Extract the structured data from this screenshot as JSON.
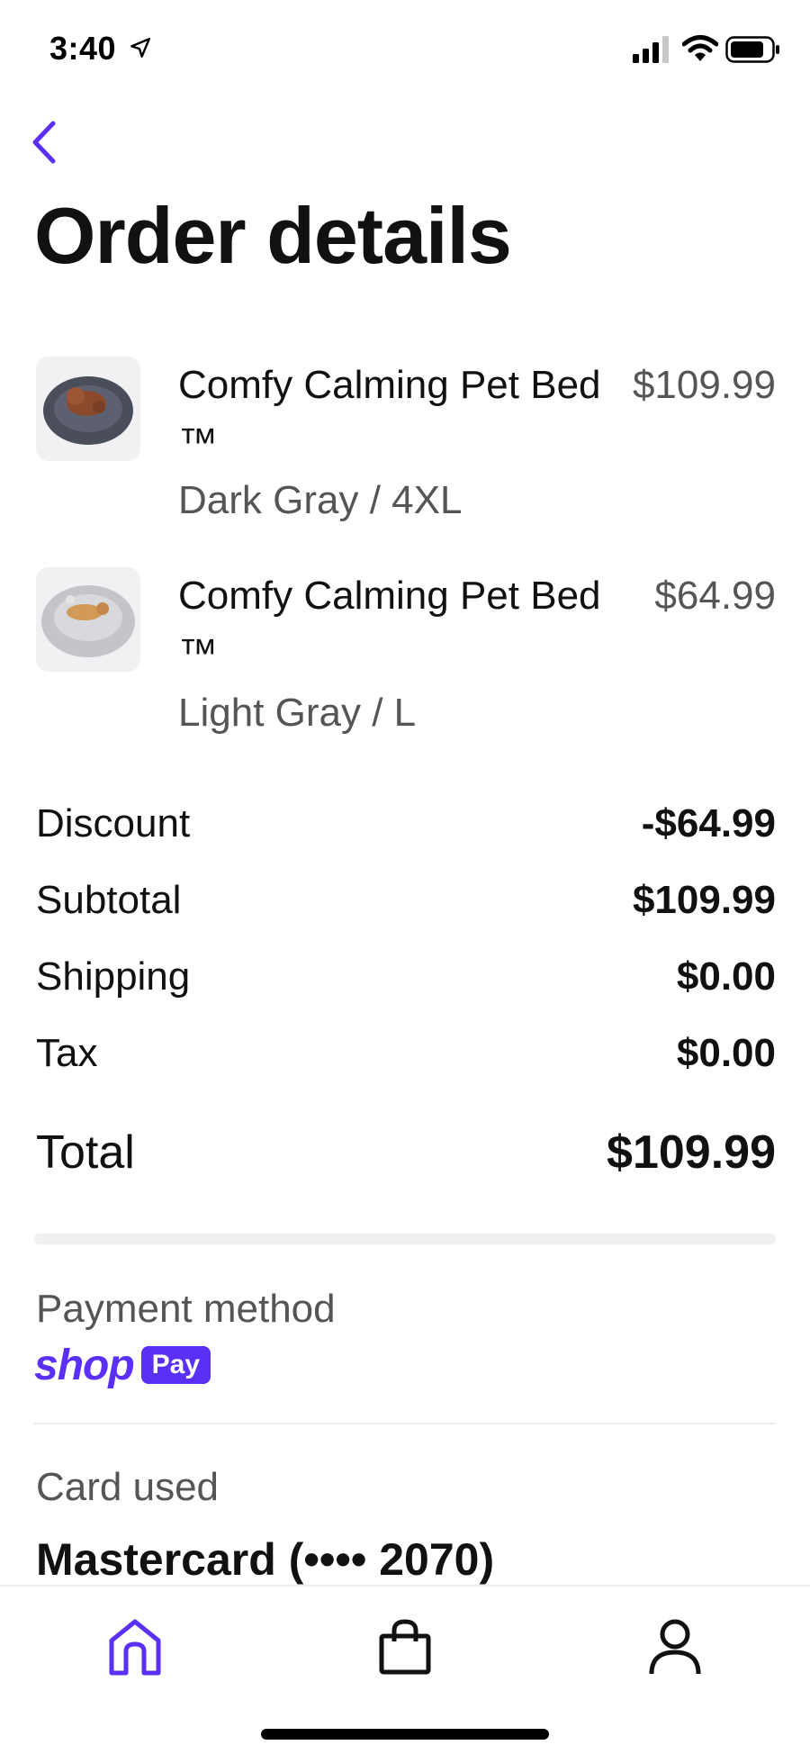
{
  "status_bar": {
    "time": "3:40",
    "icons": [
      "location-arrow-icon",
      "cellular-signal-icon",
      "wifi-icon",
      "battery-icon"
    ]
  },
  "header": {
    "back_icon": "chevron-left-icon",
    "title": "Order details"
  },
  "items": [
    {
      "name": "Comfy Calming Pet Bed ™",
      "variant": "Dark Gray / 4XL",
      "price": "$109.99",
      "thumb": "dark-gray-pet-bed-image"
    },
    {
      "name": "Comfy Calming Pet Bed ™",
      "variant": "Light Gray / L",
      "price": "$64.99",
      "thumb": "light-gray-pet-bed-image"
    }
  ],
  "summary": {
    "discount": {
      "label": "Discount",
      "value": "-$64.99"
    },
    "subtotal": {
      "label": "Subtotal",
      "value": "$109.99"
    },
    "shipping": {
      "label": "Shipping",
      "value": "$0.00"
    },
    "tax": {
      "label": "Tax",
      "value": "$0.00"
    },
    "total": {
      "label": "Total",
      "value": "$109.99"
    }
  },
  "payment": {
    "label": "Payment method",
    "logo_word": "shop",
    "logo_badge": "Pay"
  },
  "card": {
    "label": "Card used",
    "value": "Mastercard (•••• 2070)"
  },
  "tab_bar": {
    "tabs": [
      "home-icon",
      "shopping-bag-icon",
      "profile-icon"
    ],
    "active": "home-icon"
  },
  "colors": {
    "accent": "#5a31f4",
    "text_primary": "#111111",
    "text_secondary": "#555555"
  }
}
